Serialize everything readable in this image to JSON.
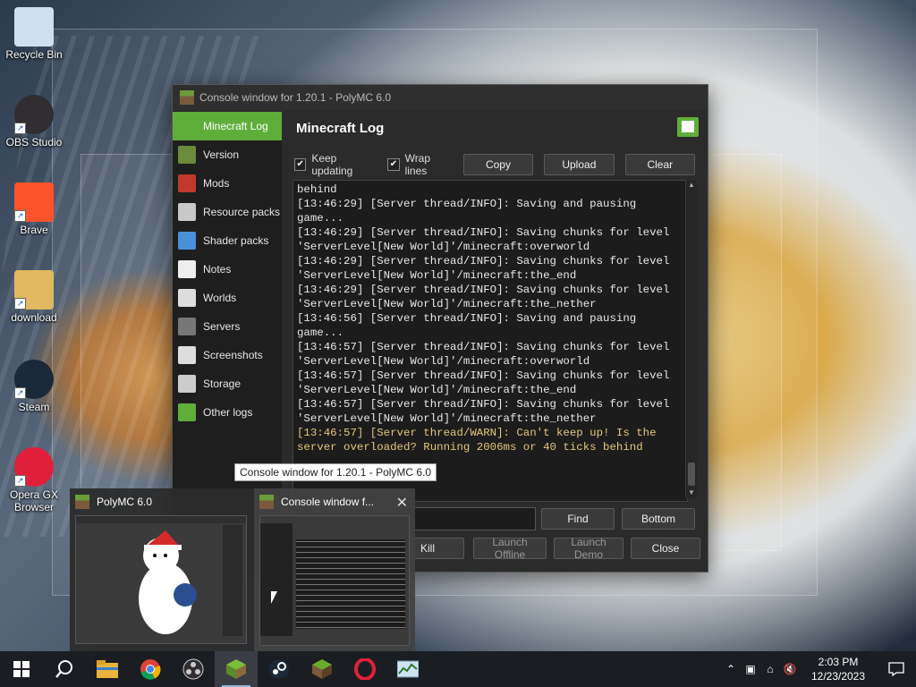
{
  "desktop": {
    "icons": [
      {
        "label": "Recycle Bin",
        "icon": "recycle-bin-icon"
      },
      {
        "label": "OBS Studio",
        "icon": "obs-icon"
      },
      {
        "label": "Brave",
        "icon": "brave-icon"
      },
      {
        "label": "download",
        "icon": "image-file-icon"
      },
      {
        "label": "Steam",
        "icon": "steam-icon"
      },
      {
        "label": "Opera GX Browser",
        "icon": "opera-gx-icon"
      }
    ]
  },
  "window": {
    "title": "Console window for 1.20.1 - PolyMC 6.0",
    "page_title": "Minecraft Log",
    "sidebar": [
      {
        "label": "Minecraft Log",
        "icon": "book-icon",
        "color": "#5fae3a"
      },
      {
        "label": "Version",
        "icon": "grass-block-icon",
        "color": "#6b8a3a"
      },
      {
        "label": "Mods",
        "icon": "star-icon",
        "color": "#c0392b"
      },
      {
        "label": "Resource packs",
        "icon": "package-icon",
        "color": "#c8c8c8"
      },
      {
        "label": "Shader packs",
        "icon": "cube-icon",
        "color": "#4a90d9"
      },
      {
        "label": "Notes",
        "icon": "notes-icon",
        "color": "#eeeeee"
      },
      {
        "label": "Worlds",
        "icon": "globe-icon",
        "color": "#dddddd"
      },
      {
        "label": "Servers",
        "icon": "server-icon",
        "color": "#777777"
      },
      {
        "label": "Screenshots",
        "icon": "image-icon",
        "color": "#dddddd"
      },
      {
        "label": "Storage",
        "icon": "storage-icon",
        "color": "#cccccc"
      },
      {
        "label": "Other logs",
        "icon": "book-icon",
        "color": "#5fae3a"
      }
    ],
    "toolbar": {
      "keep_updating": "Keep updating",
      "wrap_lines": "Wrap lines",
      "copy": "Copy",
      "upload": "Upload",
      "clear": "Clear"
    },
    "log_lines": [
      {
        "text": "behind",
        "level": "info"
      },
      {
        "text": "[13:46:29] [Server thread/INFO]: Saving and pausing game...",
        "level": "info"
      },
      {
        "text": "[13:46:29] [Server thread/INFO]: Saving chunks for level 'ServerLevel[New World]'/minecraft:overworld",
        "level": "info"
      },
      {
        "text": "[13:46:29] [Server thread/INFO]: Saving chunks for level 'ServerLevel[New World]'/minecraft:the_end",
        "level": "info"
      },
      {
        "text": "[13:46:29] [Server thread/INFO]: Saving chunks for level 'ServerLevel[New World]'/minecraft:the_nether",
        "level": "info"
      },
      {
        "text": "[13:46:56] [Server thread/INFO]: Saving and pausing game...",
        "level": "info"
      },
      {
        "text": "[13:46:57] [Server thread/INFO]: Saving chunks for level 'ServerLevel[New World]'/minecraft:overworld",
        "level": "info"
      },
      {
        "text": "[13:46:57] [Server thread/INFO]: Saving chunks for level 'ServerLevel[New World]'/minecraft:the_end",
        "level": "info"
      },
      {
        "text": "[13:46:57] [Server thread/INFO]: Saving chunks for level 'ServerLevel[New World]'/minecraft:the_nether",
        "level": "info"
      },
      {
        "text": "[13:46:57] [Server thread/WARN]: Can't keep up! Is the server overloaded? Running 2006ms or 40 ticks behind",
        "level": "warn"
      }
    ],
    "search": {
      "find": "Find",
      "bottom": "Bottom",
      "value": ""
    },
    "bottom_buttons": {
      "kill": "Kill",
      "launch_offline": "Launch Offline",
      "launch_demo": "Launch Demo",
      "close": "Close"
    }
  },
  "tooltip": "Console window for 1.20.1 - PolyMC 6.0",
  "thumbnails": [
    {
      "title": "PolyMC 6.0"
    },
    {
      "title": "Console window f..."
    }
  ],
  "taskbar": {
    "apps": [
      "start-icon",
      "search-icon",
      "file-explorer-icon",
      "chrome-icon",
      "obs-icon",
      "polymc-icon",
      "steam-icon",
      "minecraft-icon",
      "opera-gx-icon",
      "task-manager-icon"
    ],
    "clock_time": "2:03 PM",
    "clock_date": "12/23/2023"
  }
}
